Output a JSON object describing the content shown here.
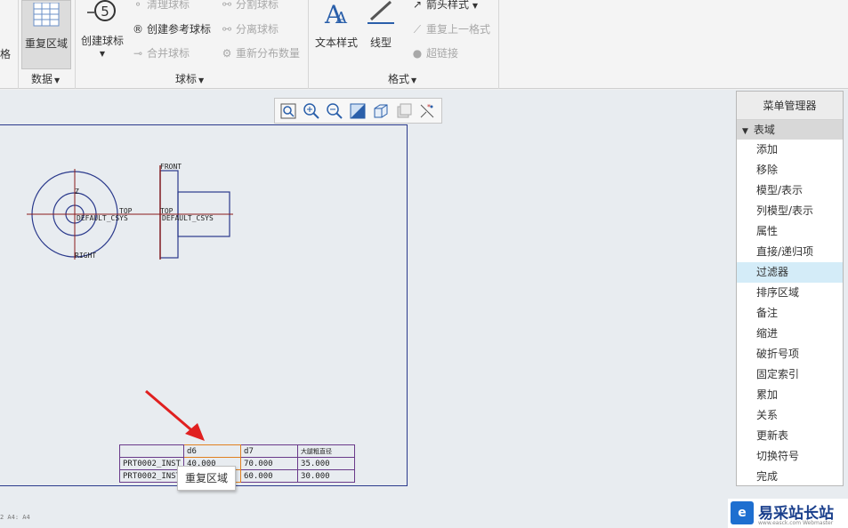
{
  "ribbon": {
    "cut_left_label": "格",
    "repeat_region_label": "重复区域",
    "data_group_label": "数据",
    "create_balloon_label": "创建球标",
    "clear_balloon_label": "清理球标",
    "create_ref_balloon_label": "创建参考球标",
    "merge_balloon_label": "合并球标",
    "split_balloon_label": "分割球标",
    "separate_balloon_label": "分离球标",
    "redistribute_label": "重新分布数量",
    "balloon_group_label": "球标",
    "text_style_label": "文本样式",
    "line_style_label": "线型",
    "arrow_style_label": "箭头样式",
    "repeat_format_label": "重复上一格式",
    "hyperlink_label": "超链接",
    "format_group_label": "格式"
  },
  "drawing": {
    "front_label": "FRONT",
    "top_label": "TOP",
    "right_label": "RIGHT",
    "csys_label_1": "DEFAULT_CSYS",
    "top_label_2": "TOP",
    "csys_label_2": "DEFAULT_CSYS",
    "z_label": "Z"
  },
  "menu_manager": {
    "title": "菜单管理器",
    "section": "表域",
    "items": [
      "添加",
      "移除",
      "模型/表示",
      "列模型/表示",
      "属性",
      "直接/递归项",
      "过滤器",
      "排序区域",
      "备注",
      "缩进",
      "破折号项",
      "固定索引",
      "累加",
      "关系",
      "更新表",
      "切换符号",
      "完成"
    ],
    "active_index": 6
  },
  "table": {
    "header": [
      "",
      "d6",
      "d7",
      "大腿粗直径"
    ],
    "rows": [
      [
        "PRT0002_INST",
        "40.000",
        "70.000",
        "35.000"
      ],
      [
        "PRT0002_INST",
        "",
        "60.000",
        "30.000"
      ]
    ]
  },
  "tooltip": "重复区域",
  "status_text": "2  A4: A4",
  "watermark": {
    "text": "易采站长站",
    "sub": "www.easck.com Webmaster"
  }
}
